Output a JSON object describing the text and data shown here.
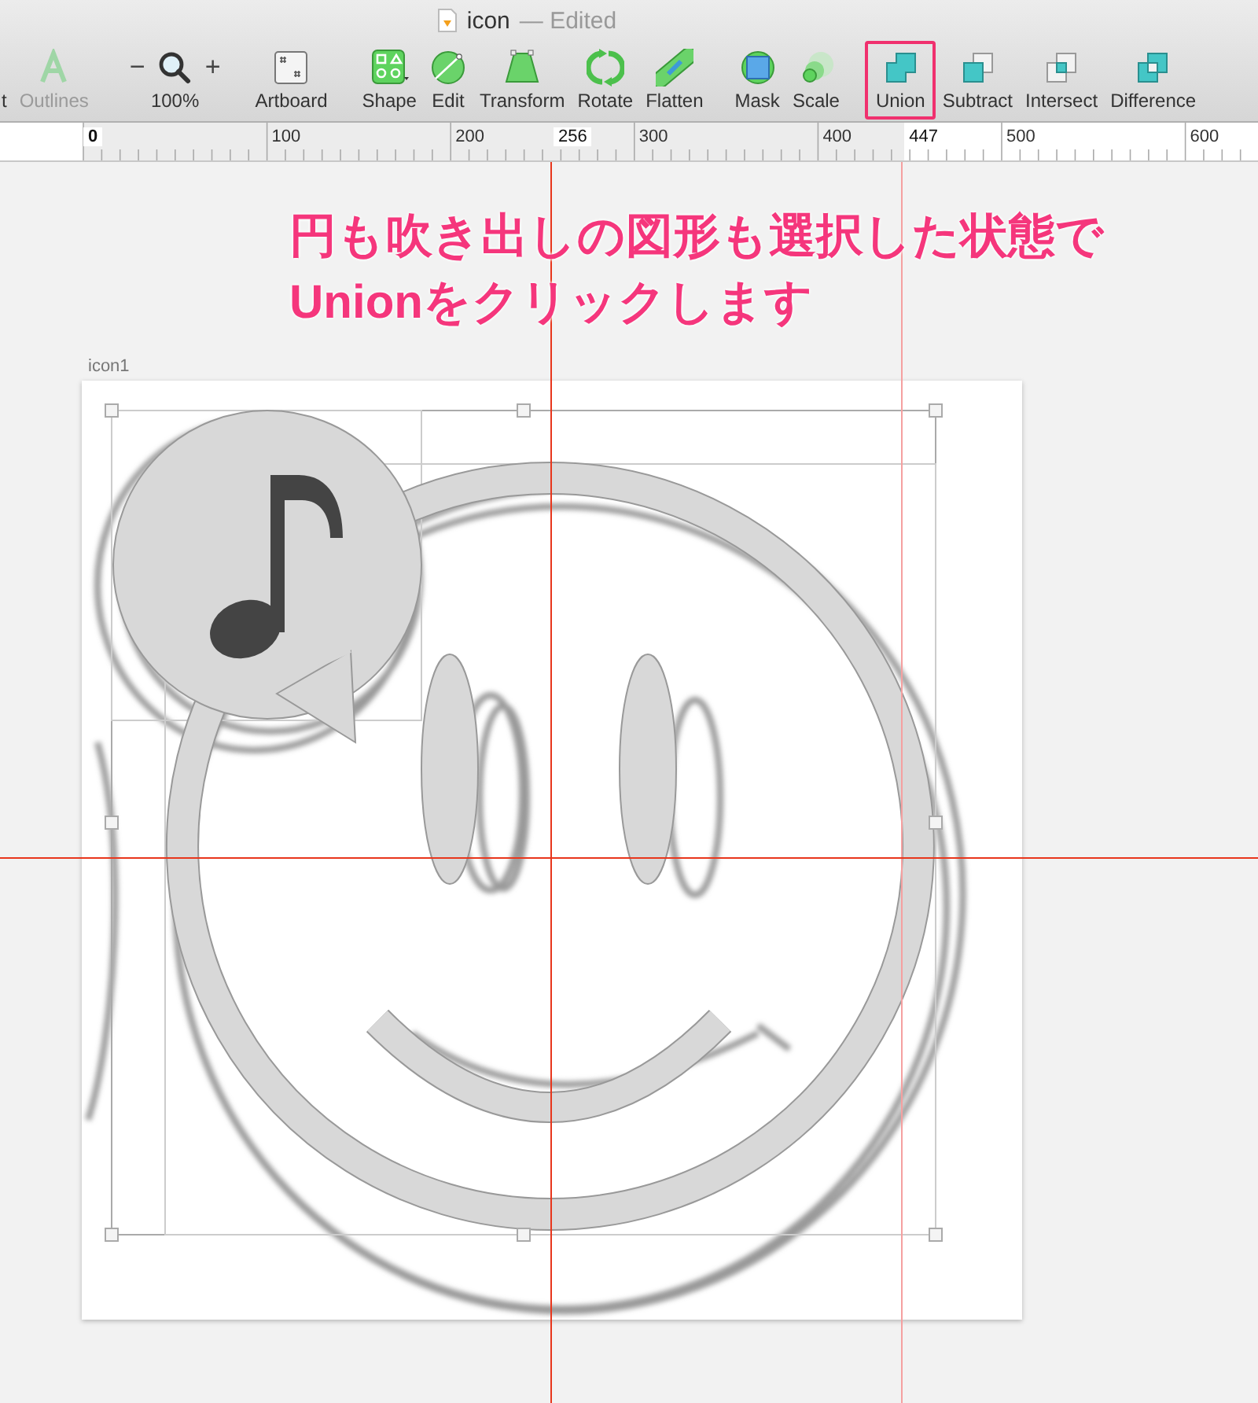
{
  "window": {
    "title": "icon",
    "status": "— Edited"
  },
  "toolbar": {
    "groups": [
      {
        "items": [
          {
            "kind": "text",
            "label": "t",
            "disabled": false,
            "highlighted": false
          },
          {
            "kind": "outlines",
            "label": "Outlines",
            "disabled": true,
            "highlighted": false
          }
        ]
      },
      {
        "items": [
          {
            "kind": "zoom",
            "label": "100%",
            "decrease": "−",
            "increase": "+",
            "disabled": false,
            "highlighted": false
          }
        ]
      },
      {
        "items": [
          {
            "kind": "artboard",
            "label": "Artboard",
            "disabled": false,
            "highlighted": false
          }
        ]
      },
      {
        "items": [
          {
            "kind": "shape",
            "label": "Shape",
            "disabled": false,
            "highlighted": false
          },
          {
            "kind": "edit",
            "label": "Edit",
            "disabled": false,
            "highlighted": false
          },
          {
            "kind": "transform",
            "label": "Transform",
            "disabled": false,
            "highlighted": false
          },
          {
            "kind": "rotate",
            "label": "Rotate",
            "disabled": false,
            "highlighted": false
          },
          {
            "kind": "flatten",
            "label": "Flatten",
            "disabled": false,
            "highlighted": false
          }
        ]
      },
      {
        "items": [
          {
            "kind": "mask",
            "label": "Mask",
            "disabled": false,
            "highlighted": false
          },
          {
            "kind": "scale",
            "label": "Scale",
            "disabled": false,
            "highlighted": false
          }
        ]
      },
      {
        "items": [
          {
            "kind": "union",
            "label": "Union",
            "disabled": false,
            "highlighted": true
          },
          {
            "kind": "subtract",
            "label": "Subtract",
            "disabled": false,
            "highlighted": false
          },
          {
            "kind": "intersect",
            "label": "Intersect",
            "disabled": false,
            "highlighted": false
          },
          {
            "kind": "difference",
            "label": "Difference",
            "disabled": false,
            "highlighted": false
          }
        ]
      }
    ]
  },
  "ruler": {
    "marks": [
      {
        "label": "0",
        "kind": "origin"
      },
      {
        "label": "100",
        "kind": "tick"
      },
      {
        "label": "200",
        "kind": "tick"
      },
      {
        "label": "256",
        "kind": "guide"
      },
      {
        "label": "300",
        "kind": "tick"
      },
      {
        "label": "400",
        "kind": "tick"
      },
      {
        "label": "447",
        "kind": "guide"
      },
      {
        "label": "500",
        "kind": "tick"
      },
      {
        "label": "600",
        "kind": "tick"
      }
    ]
  },
  "annotation": {
    "lines": [
      "円も吹き出しの図形も選択した状態で",
      "Unionをクリックします"
    ]
  },
  "artboard": {
    "name": "icon1"
  }
}
